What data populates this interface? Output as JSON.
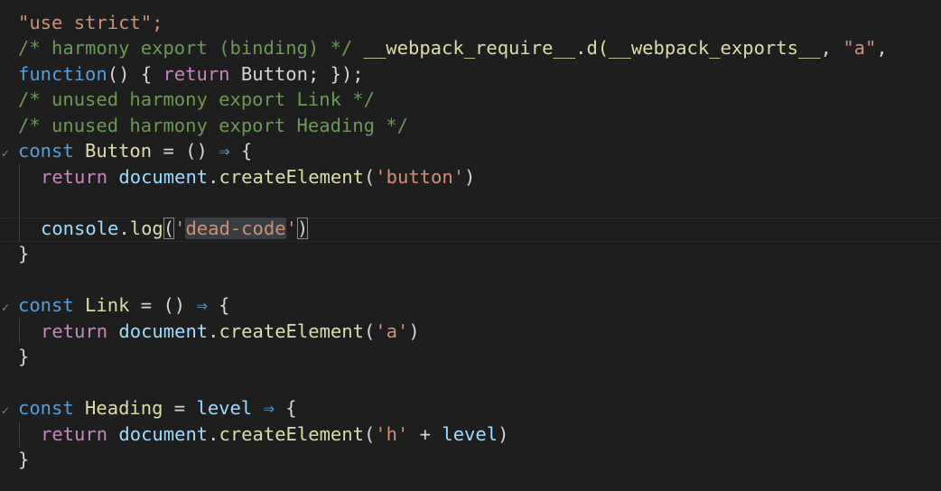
{
  "editor": {
    "lines": {
      "l1": {
        "str": "\"use strict\";"
      },
      "l2": {
        "comment": "/* harmony export (binding) */ ",
        "req": "__webpack_require__",
        "dot_d": ".d(",
        "exports": "__webpack_exports__",
        "comma1": ", ",
        "a_str": "\"a\"",
        "comma2": ","
      },
      "l3": {
        "function_kw": "function",
        "parens": "() { ",
        "return_kw": "return",
        "ident": " Button",
        "end": "; });"
      },
      "l4": {
        "comment": "/* unused harmony export Link */"
      },
      "l5": {
        "comment": "/* unused harmony export Heading */"
      },
      "l6": {
        "const_kw": "const",
        "name": " Button",
        "eq": " = () ",
        "arrow": "⇒",
        "brace": " {"
      },
      "l7": {
        "return_kw": "return",
        "obj": " document",
        "dot": ".",
        "fn": "createElement",
        "open": "(",
        "arg": "'button'",
        "close": ")"
      },
      "l8": {
        "text": ""
      },
      "l9": {
        "obj": "console",
        "dot": ".",
        "fn": "log",
        "open": "(",
        "q1": "'",
        "arg": "dead-code",
        "q2": "'",
        "close": ")"
      },
      "l10": {
        "brace": "}"
      },
      "l11": {
        "text": ""
      },
      "l12": {
        "const_kw": "const",
        "name": " Link",
        "eq": " = () ",
        "arrow": "⇒",
        "brace": " {"
      },
      "l13": {
        "return_kw": "return",
        "obj": " document",
        "dot": ".",
        "fn": "createElement",
        "open": "(",
        "arg": "'a'",
        "close": ")"
      },
      "l14": {
        "brace": "}"
      },
      "l15": {
        "text": ""
      },
      "l16": {
        "const_kw": "const",
        "name": " Heading",
        "eq": " = ",
        "param": "level",
        "sp": " ",
        "arrow": "⇒",
        "brace": " {"
      },
      "l17": {
        "return_kw": "return",
        "obj": " document",
        "dot": ".",
        "fn": "createElement",
        "open": "(",
        "arg": "'h'",
        "plus": " + ",
        "param": "level",
        "close": ")"
      },
      "l18": {
        "brace": "}"
      }
    },
    "fold_icon_glyph": "✓",
    "colors": {
      "background": "#1e1e1e",
      "string": "#ce9178",
      "comment": "#6a9955",
      "keyword": "#569cd6",
      "control": "#c586c0",
      "function": "#dcdcaa",
      "variable": "#9cdcfe"
    }
  }
}
